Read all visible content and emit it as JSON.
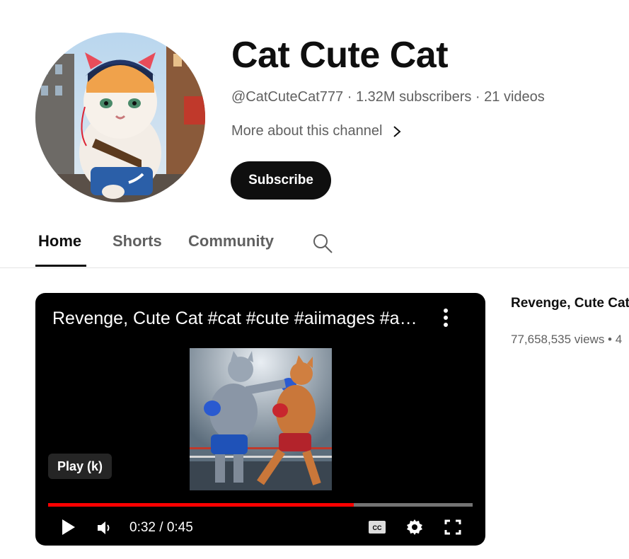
{
  "channel": {
    "name": "Cat Cute Cat",
    "handle": "@CatCuteCat777",
    "subscribers": "1.32M subscribers",
    "videos": "21 videos",
    "meta_separator": " · ",
    "more_label": "More about this channel",
    "subscribe_label": "Subscribe"
  },
  "tabs": [
    {
      "label": "Home",
      "active": true
    },
    {
      "label": "Shorts",
      "active": false
    },
    {
      "label": "Community",
      "active": false
    }
  ],
  "player": {
    "title": "Revenge, Cute Cat #cat #cute #aiimages #aiart #ai #cats",
    "tooltip": "Play (k)",
    "current_time": "0:32",
    "duration": "0:45",
    "time_display": "0:32 / 0:45",
    "progress": 0.72
  },
  "featured": {
    "title": "Revenge, Cute Cat",
    "views": "77,658,535 views",
    "meta_suffix": " • 4"
  },
  "icons": {
    "search": "search-icon",
    "more": "chevron-right-icon",
    "kebab": "more-vert-icon",
    "play": "play-icon",
    "volume": "volume-icon",
    "cc": "closed-captions-icon",
    "settings": "gear-icon",
    "fullscreen": "fullscreen-icon"
  },
  "colors": {
    "progress": "#ff0000",
    "subscribe_bg": "#0f0f0f"
  }
}
